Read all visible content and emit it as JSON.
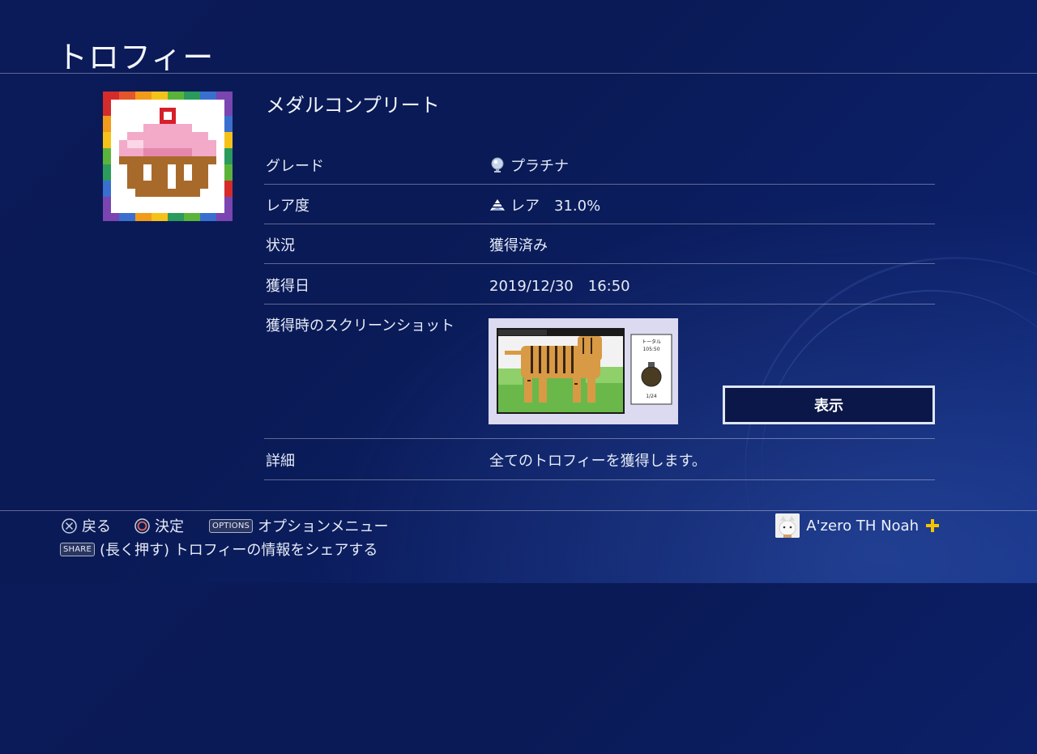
{
  "header": {
    "title": "トロフィー"
  },
  "trophy": {
    "name": "メダルコンプリート",
    "rows": [
      {
        "label": "グレード",
        "value": "プラチナ",
        "icon": "platinum-trophy-icon"
      },
      {
        "label": "レア度",
        "value": "レア　31.0%",
        "icon": "rarity-pyramid-icon"
      },
      {
        "label": "状況",
        "value": "獲得済み"
      },
      {
        "label": "獲得日",
        "value": "2019/12/30　16:50"
      },
      {
        "label": "獲得時のスクリーンショット"
      },
      {
        "label": "詳細",
        "value": "全てのトロフィーを獲得します。"
      }
    ],
    "show_button": "表示",
    "screenshot": {
      "panel_title": "トータル",
      "panel_time": "105:50",
      "panel_count": "1/24"
    }
  },
  "footer": {
    "back": "戻る",
    "confirm": "決定",
    "options_tag": "OPTIONS",
    "options_label": "オプションメニュー",
    "share_tag": "SHARE",
    "share_label": "(長く押す) トロフィーの情報をシェアする"
  },
  "user": {
    "name": "A'zero TH Noah",
    "plus_icon": "ps-plus-icon"
  },
  "colors": {
    "background": "#0b1a58",
    "plus": "#f5c400"
  }
}
